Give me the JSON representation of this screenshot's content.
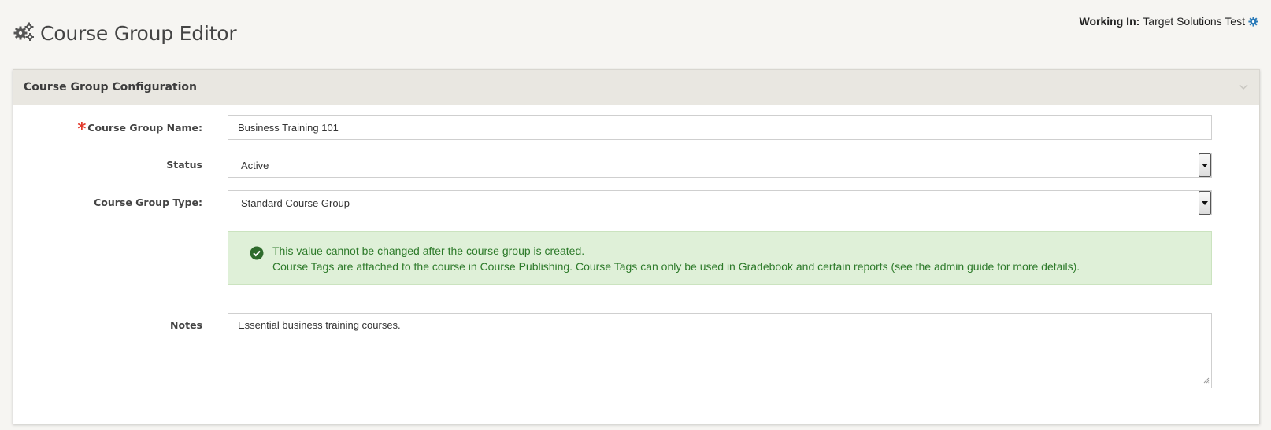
{
  "page": {
    "title": "Course Group Editor",
    "title_icon": "gears-icon"
  },
  "working_in": {
    "label": "Working In:",
    "value": "Target Solutions Test",
    "icon": "gear-icon",
    "icon_color": "#2a7ab8"
  },
  "panel": {
    "title": "Course Group Configuration",
    "collapse_icon": "chevron-down-icon"
  },
  "form": {
    "required_marker": "*",
    "name_label": "Course Group Name:",
    "name_value": "Business Training 101",
    "status_label": "Status",
    "status_value": "Active",
    "type_label": "Course Group Type:",
    "type_value": "Standard Course Group",
    "notes_label": "Notes",
    "notes_value": "Essential business training courses."
  },
  "alert": {
    "icon": "check-circle-icon",
    "line1": "This value cannot be changed after the course group is created.",
    "line2": "Course Tags are attached to the course in Course Publishing. Course Tags can only be used in Gradebook and certain reports (see the admin guide for more details).",
    "background": "#dff0d8",
    "text_color": "#2d7a2a"
  },
  "colors": {
    "page_bg": "#f6f5f2",
    "panel_header_bg": "#e9e7e1",
    "required": "#e23a2c"
  }
}
